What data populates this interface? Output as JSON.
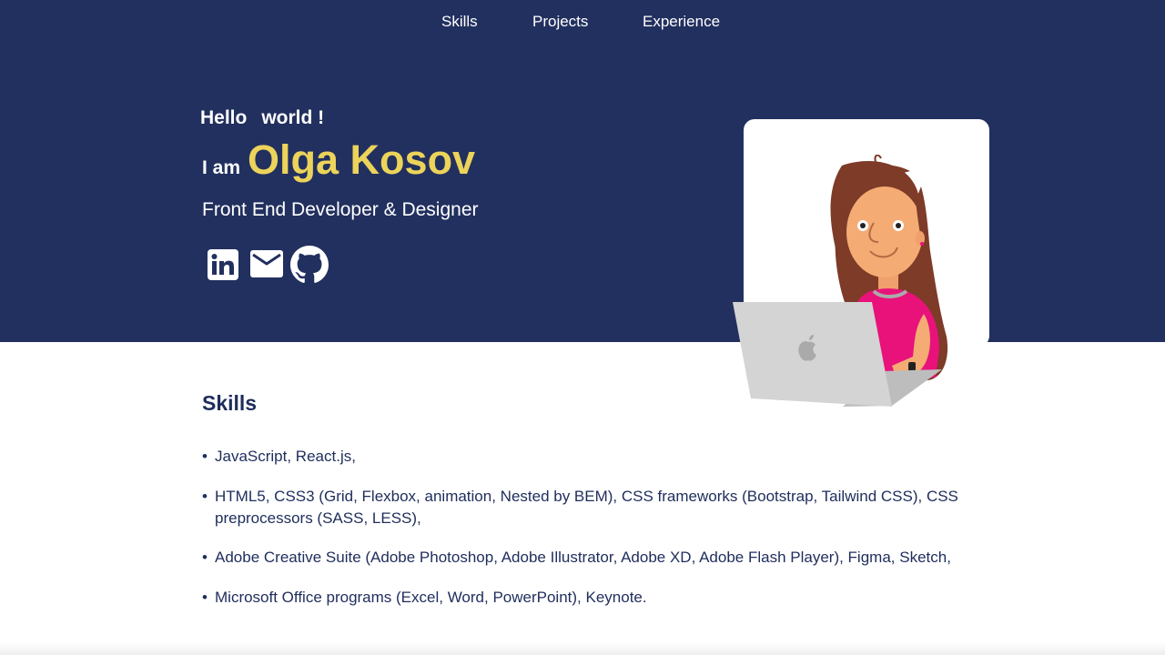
{
  "nav": {
    "items": [
      {
        "label": "Skills"
      },
      {
        "label": "Projects"
      },
      {
        "label": "Experience"
      }
    ]
  },
  "hero": {
    "greeting_word1": "Hello",
    "greeting_word2": "world !",
    "iam": "I am",
    "name": "Olga Kosov",
    "role": "Front End Developer & Designer",
    "socials": [
      {
        "icon": "linkedin-icon"
      },
      {
        "icon": "mail-icon"
      },
      {
        "icon": "github-icon"
      }
    ]
  },
  "skills": {
    "title": "Skills",
    "items": [
      "JavaScript, React.js,",
      "HTML5, CSS3 (Grid, Flexbox, animation, Nested by BEM), CSS frameworks (Bootstrap, Tailwind CSS), CSS preprocessors (SASS, LESS),",
      "Adobe Creative Suite (Adobe Photoshop, Adobe Illustrator, Adobe XD, Adobe Flash Player), Figma, Sketch,",
      "Microsoft Office programs (Excel, Word, PowerPoint), Keynote."
    ]
  },
  "colors": {
    "hero_bg": "#22305f",
    "accent_name": "#ecd35a",
    "text_dark": "#1f2d5c"
  }
}
